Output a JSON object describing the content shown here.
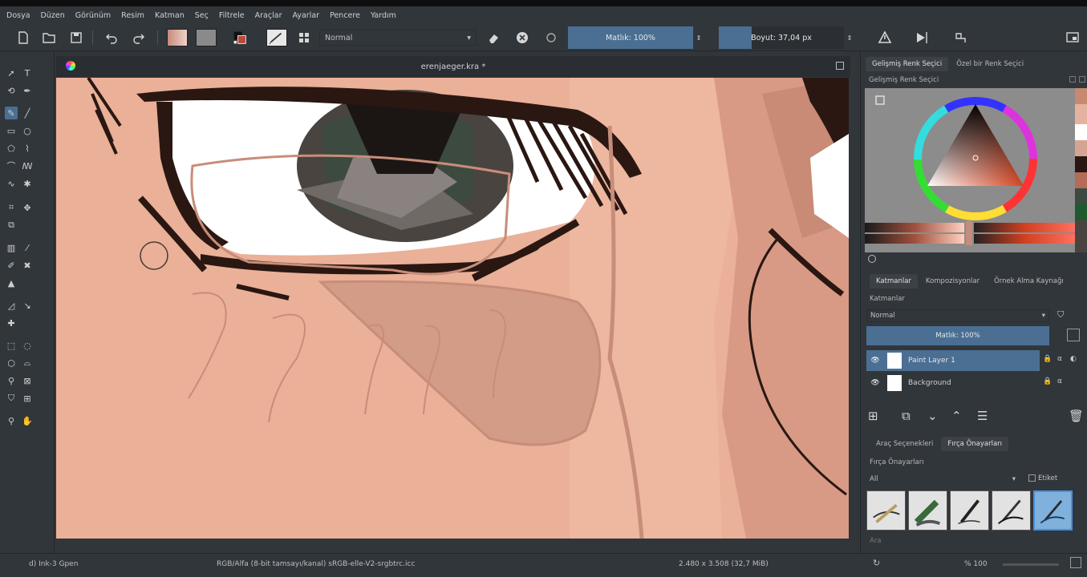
{
  "menu": [
    "Dosya",
    "Düzen",
    "Görünüm",
    "Resim",
    "Katman",
    "Seç",
    "Filtrele",
    "Araçlar",
    "Ayarlar",
    "Pencere",
    "Yardım"
  ],
  "toolbar": {
    "blend_mode": "Normal",
    "opacity_label": "Matlık: 100%",
    "opacity_fraction": 1.0,
    "size_label": "Boyut: 37,04 px",
    "size_fraction": 0.26
  },
  "document": {
    "tab_title": "erenjaeger.kra *"
  },
  "colors": {
    "foreground": "#c58b7c",
    "background": "#8a8a8a",
    "accent": "#4a6f93",
    "skin": "#e9ad96",
    "lineart": "#2a1712"
  },
  "dockers": {
    "color_tabs": [
      "Gelişmiş Renk Seçici",
      "Özel bir Renk Seçici"
    ],
    "color_title": "Gelişmiş Renk Seçici",
    "layer_tabs": [
      "Katmanlar",
      "Kompozisyonlar",
      "Örnek Alma Kaynağı"
    ],
    "layers_title": "Katmanlar",
    "layers_blend": "Normal",
    "layers_opacity": "Matlık: 100%",
    "layers": [
      {
        "name": "Paint Layer 1",
        "selected": true
      },
      {
        "name": "Background",
        "selected": false
      }
    ],
    "brush_tabs": [
      "Araç Seçenekleri",
      "Fırça Önayarları"
    ],
    "brush_title": "Fırça Önayarları",
    "brush_filter": "All",
    "brush_tag_label": "Etiket",
    "brush_search_placeholder": "Ara"
  },
  "status": {
    "brush_name": "d) Ink-3 Gpen",
    "color_profile": "RGB/Alfa (8-bit tamsayı/kanal)  sRGB-elle-V2-srgbtrc.icc",
    "image_size": "2.480 x 3.508 (32,7 MiB)",
    "zoom": "% 100"
  }
}
